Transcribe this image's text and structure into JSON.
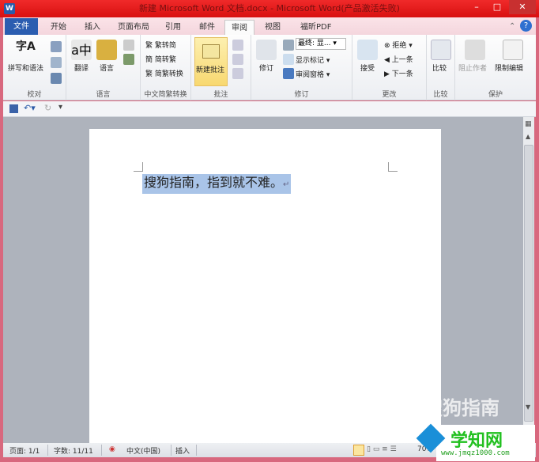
{
  "title": "新建 Microsoft Word 文档.docx - Microsoft Word(产品激活失败)",
  "app_icon": "W",
  "window_buttons": {
    "minimize": "–",
    "maximize": "□",
    "close": "✕"
  },
  "tabs": [
    "文件",
    "开始",
    "插入",
    "页面布局",
    "引用",
    "邮件",
    "审阅",
    "视图",
    "福昕PDF"
  ],
  "active_tab": "审阅",
  "ribbon": {
    "proofing": {
      "label": "校对",
      "spell": "拼写和语法",
      "spell_glyph": "字A"
    },
    "language": {
      "label": "语言",
      "translate": "翻译",
      "language": "语言"
    },
    "chinese_conv": {
      "label": "中文简繁转换",
      "t2s": "繁转简",
      "s2t": "简转繁",
      "convert": "简繁转换"
    },
    "comments": {
      "label": "批注",
      "new_comment": "新建批注"
    },
    "tracking": {
      "label": "修订",
      "track": "修订",
      "display": "最终: 显...",
      "show_markup": "显示标记",
      "review_pane": "审阅窗格"
    },
    "changes": {
      "label": "更改",
      "accept": "接受",
      "reject": "拒绝",
      "previous": "上一条",
      "next": "下一条"
    },
    "compare": {
      "label": "比较",
      "compare": "比较"
    },
    "protect": {
      "label": "保护",
      "block_authors": "阻止作者",
      "restrict": "限制编辑"
    }
  },
  "document": {
    "text": "搜狗指南，指到就不难。",
    "para_mark": "↵"
  },
  "status": {
    "page": "页面: 1/1",
    "words": "字数: 11/11",
    "language": "中文(中国)",
    "mode": "插入",
    "zoom": "70%"
  },
  "watermark": "搜狗指南",
  "site_logo": {
    "name": "学知网",
    "url": "www.jmqz1000.com"
  }
}
